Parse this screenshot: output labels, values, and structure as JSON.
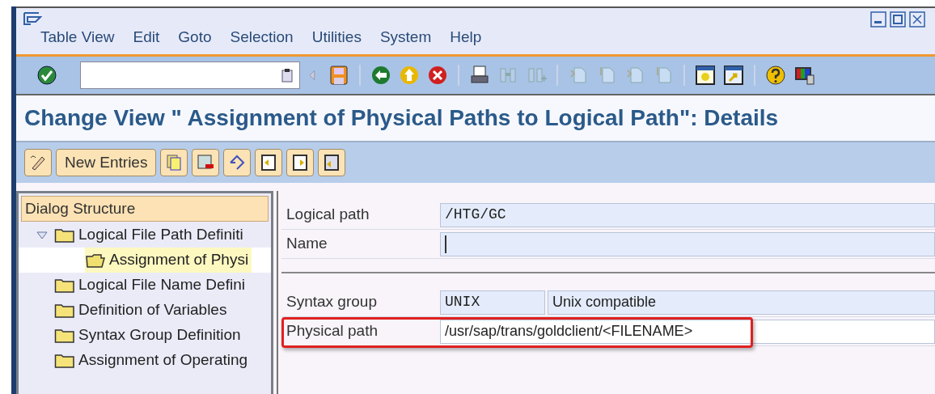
{
  "menu": [
    {
      "label": "Table View"
    },
    {
      "label": "Edit"
    },
    {
      "label": "Goto"
    },
    {
      "label": "Selection"
    },
    {
      "label": "Utilities"
    },
    {
      "label": "System"
    },
    {
      "label": "Help"
    }
  ],
  "title": "Change View \" Assignment of Physical Paths to Logical Path\": Details",
  "app_toolbar": {
    "new_entries": "New Entries"
  },
  "dialog_structure": {
    "header": "Dialog Structure",
    "items": [
      {
        "label": "Logical File Path Definiti",
        "expanded": true,
        "selected": false,
        "children": [
          {
            "label": "Assignment of Physi",
            "selected": true
          }
        ]
      },
      {
        "label": "Logical File Name Defini",
        "selected": false
      },
      {
        "label": "Definition of Variables",
        "selected": false
      },
      {
        "label": "Syntax Group Definition",
        "selected": false
      },
      {
        "label": "Assignment of Operating",
        "selected": false
      }
    ]
  },
  "fields": [
    {
      "label": "Logical path",
      "value": "/HTG/GC",
      "kind": "code"
    },
    {
      "label": "Name",
      "kind": "cursor"
    }
  ],
  "fields_2": [
    {
      "label": "Syntax group",
      "value": "UNIX",
      "description": "Unix compatible",
      "kind": "pair",
      "highlighted": false
    },
    {
      "label": "Physical path",
      "value": "/usr/sap/trans/goldclient/<FILENAME>",
      "kind": "text",
      "highlighted": true
    }
  ]
}
